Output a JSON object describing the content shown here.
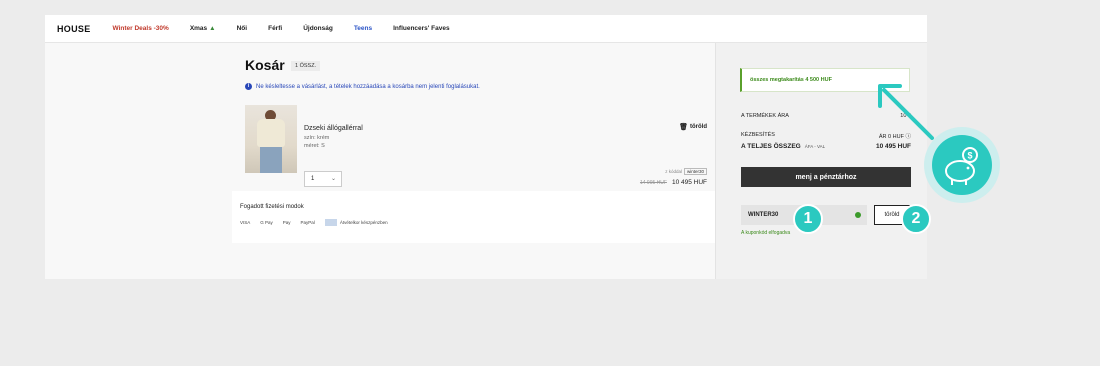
{
  "nav": {
    "logo": "HOUSE",
    "items": [
      "Winter Deals -30%",
      "Xmas",
      "Női",
      "Férfi",
      "Újdonság",
      "Teens",
      "Influencers' Faves"
    ]
  },
  "cart": {
    "title": "Kosár",
    "count": "1 ÖSSZ.",
    "info": "Ne késleltesse a vásárlást, a tételek hozzáadása a kosárba nem jelenti foglalásukat.",
    "product": {
      "name": "Dzseki állógallérral",
      "color": "szín: krém",
      "size": "méret: S",
      "quantity": "1",
      "remove": "töröld",
      "coupon_label": "z kóddal",
      "coupon_code": "winter30",
      "old_price": "14 995 HUF",
      "price": "10 495 HUF"
    }
  },
  "payment": {
    "title": "Fogadott fizetési modok",
    "methods": [
      "VISA",
      "G Pay",
      "Pay",
      "PayPal",
      "Átvételkor készpénzben"
    ]
  },
  "summary": {
    "savings": "összes megtakarítás 4 500 HUF",
    "products_label": "A TERMÉKEK ÁRA",
    "products_value": "10 4",
    "shipping_label": "KÉZBESÍTÉS",
    "shipping_value": "ÁR 0 HUF",
    "total_label": "A TELJES ÖSSZEG",
    "total_vat": "ÁFA - VAL",
    "total_value": "10 495 HUF",
    "checkout": "menj a pénztárhoz",
    "coupon": "WINTER30",
    "coupon_remove": "töröld",
    "coupon_accepted": "A kuponkód elfogadva"
  },
  "callouts": [
    "1",
    "2"
  ],
  "colors": {
    "accent": "#2bc9c0",
    "success": "#3b8a1a",
    "info": "#2847b8",
    "deal": "#c0392b"
  }
}
